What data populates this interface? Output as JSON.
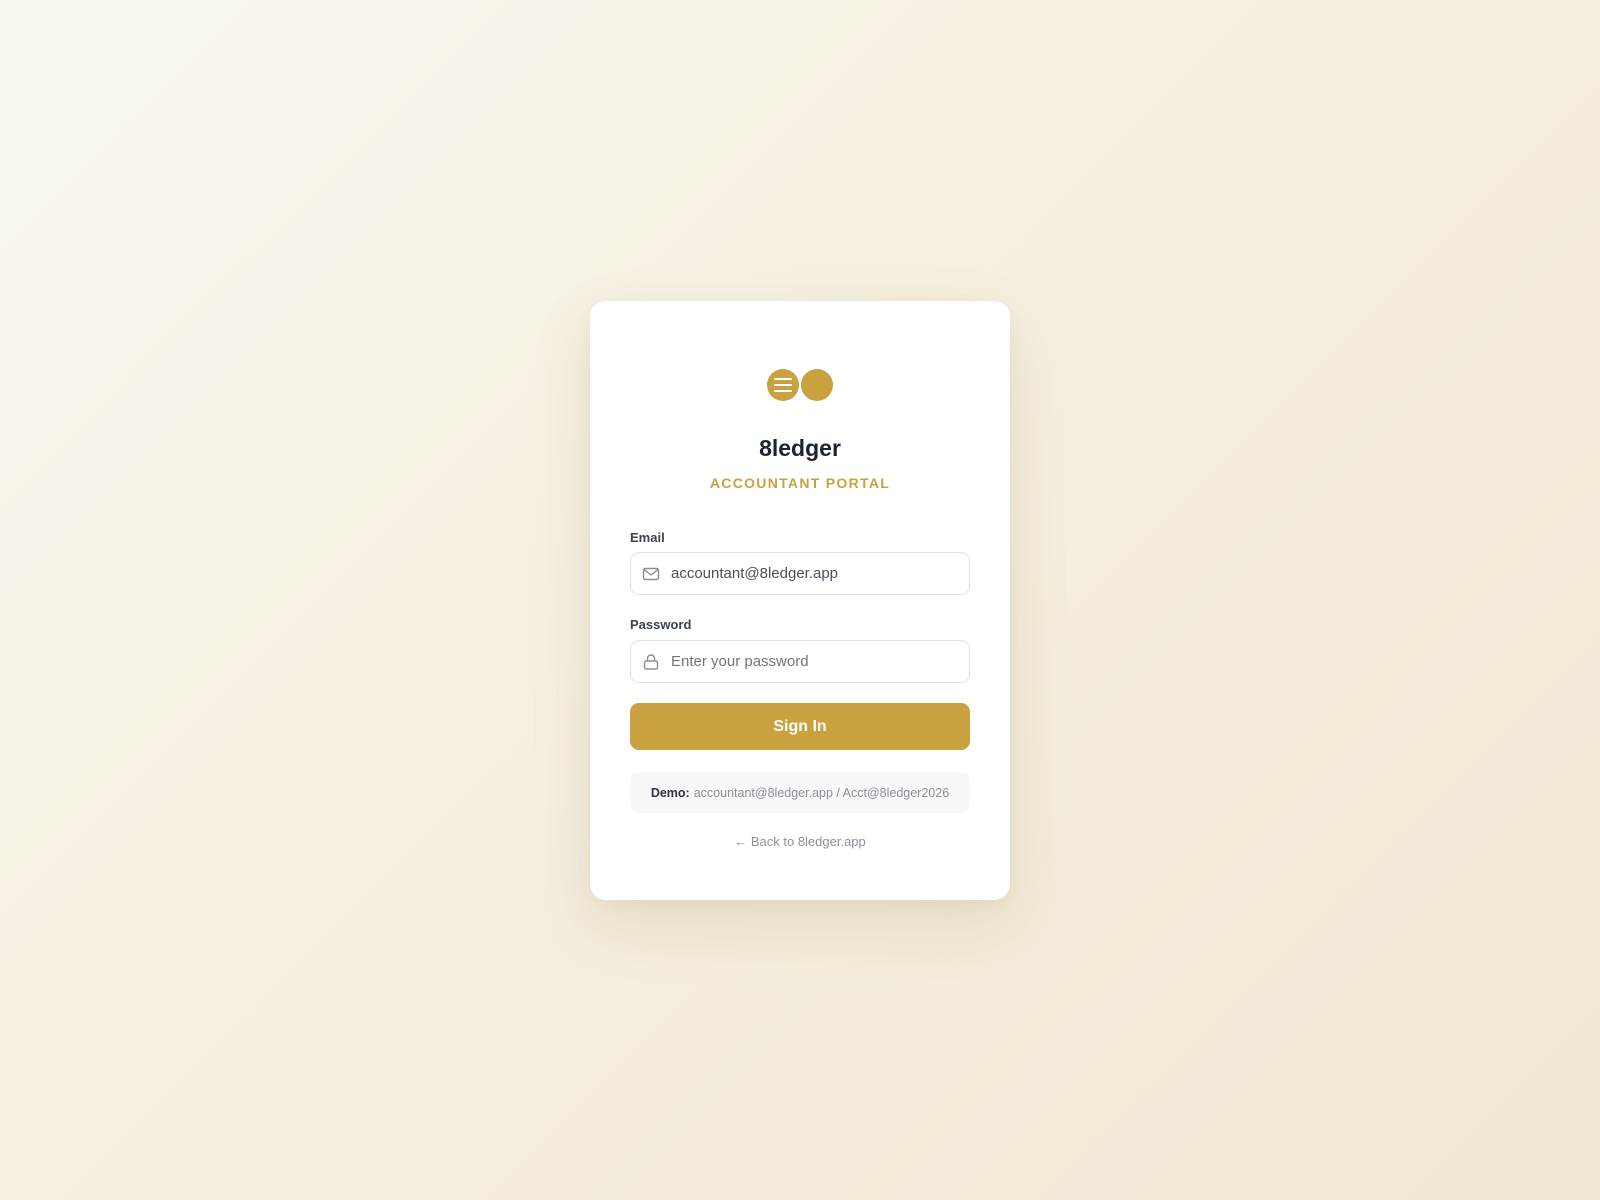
{
  "brand": {
    "name": "8ledger",
    "tagline": "ACCOUNTANT PORTAL",
    "accent_color": "#c9a13e",
    "logo_icon": "ledger-menu-icon"
  },
  "form": {
    "email": {
      "label": "Email",
      "value": "accountant@8ledger.app",
      "placeholder": "accountant@8ledger.app",
      "icon": "mail-icon"
    },
    "password": {
      "label": "Password",
      "value": "",
      "placeholder": "Enter your password",
      "icon": "lock-icon"
    },
    "submit_label": "Sign In"
  },
  "demo": {
    "label": "Demo:",
    "credentials": "accountant@8ledger.app / Acct@8ledger2026"
  },
  "back_link": {
    "label": "← Back to 8ledger.app"
  }
}
